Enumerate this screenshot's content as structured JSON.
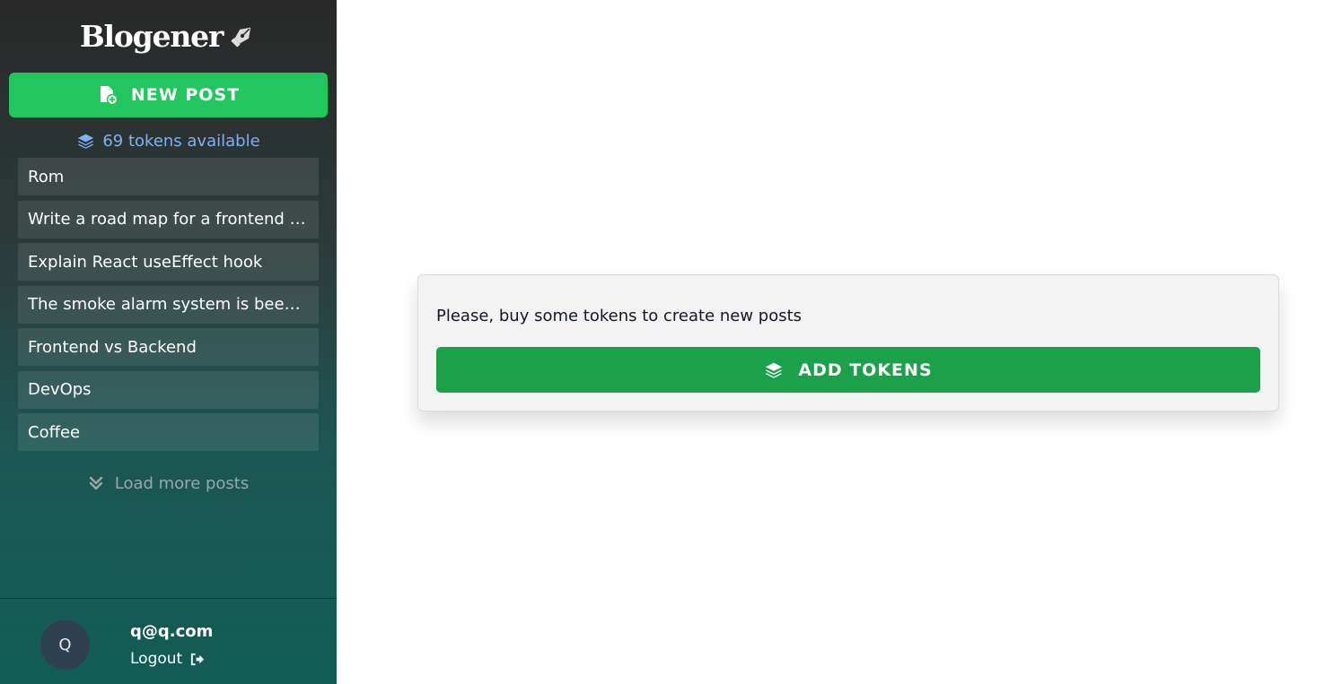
{
  "app": {
    "logo_text": "Blogener"
  },
  "sidebar": {
    "new_post_label": "NEW POST",
    "tokens_label": "69 tokens available",
    "posts": [
      {
        "title": "Rom"
      },
      {
        "title": "Write a road map for a frontend developer"
      },
      {
        "title": "Explain React useEffect hook"
      },
      {
        "title": "The smoke alarm system is beeping"
      },
      {
        "title": "Frontend vs Backend"
      },
      {
        "title": "DevOps"
      },
      {
        "title": "Coffee"
      }
    ],
    "load_more_label": "Load more posts"
  },
  "user": {
    "avatar_initial": "Q",
    "email": "q@q.com",
    "logout_label": "Logout"
  },
  "main": {
    "message": "Please, buy some tokens to create new posts",
    "add_tokens_label": "ADD TOKENS"
  },
  "colors": {
    "new_post_button": "#22c55e",
    "add_tokens_button": "#1ba14a",
    "tokens_text": "#7fb1f5"
  },
  "icons": {
    "logo": "pen-nib-icon",
    "new_post": "file-plus-icon",
    "tokens": "layer-group-icon",
    "load_more": "chevrons-down-icon",
    "logout": "sign-out-icon",
    "add_tokens": "layer-group-icon"
  }
}
